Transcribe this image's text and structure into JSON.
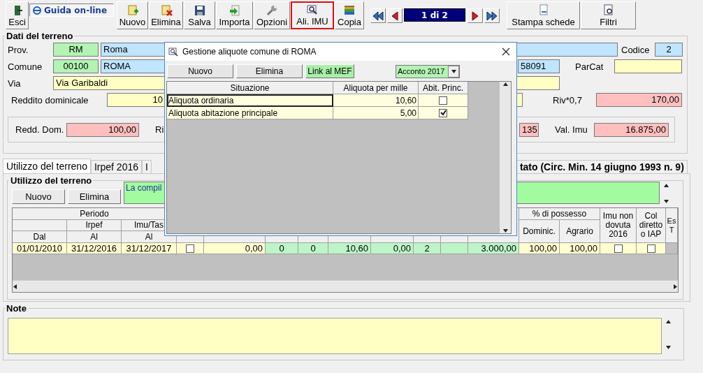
{
  "toolbar": {
    "exit": {
      "label": "Esci"
    },
    "help_link": {
      "label": "Guida on-line"
    },
    "buttons": [
      {
        "label": "Nuovo",
        "highlighted": false
      },
      {
        "label": "Elimina",
        "highlighted": false
      },
      {
        "label": "Salva",
        "highlighted": false
      },
      {
        "label": "Importa",
        "highlighted": false
      },
      {
        "label": "Opzioni",
        "highlighted": false
      },
      {
        "label": "Ali. IMU",
        "highlighted": true
      },
      {
        "label": "Copia",
        "highlighted": false
      }
    ],
    "pager": {
      "position": "1 di 2"
    },
    "print_buttons": [
      {
        "label": "Stampa schede"
      },
      {
        "label": "Filtri"
      }
    ]
  },
  "land_data": {
    "title": "Dati del terreno",
    "prov_label": "Prov.",
    "prov_code": "RM",
    "prov_name": "Roma",
    "codice_label": "Codice",
    "codice": "2",
    "comune_label": "Comune",
    "comune_code": "00100",
    "comune_name": "ROMA",
    "field_partial": "58091",
    "parcat_label": "ParCat",
    "via_label": "Via",
    "via": "Via Garibaldi",
    "reddito_label": "Reddito dominicale",
    "reddito_partial": "10",
    "riv_label": "Riv*0,7",
    "riv": "170,00",
    "summary": {
      "redd_dom_label": "Redd. Dom.",
      "redd_dom": "100,00",
      "label_partial": "Ri",
      "value_partial": "135",
      "val_imu_label": "Val. Imu",
      "val_imu": "16.875,00"
    }
  },
  "tabs": [
    {
      "label": "Utilizzo del terreno",
      "selected": true
    },
    {
      "label": "Irpef 2016",
      "selected": false
    },
    {
      "label": "I",
      "selected": false
    },
    {
      "label": "tato (Circ. Min. 14 giugno 1993 n. 9)",
      "selected": false
    }
  ],
  "usage": {
    "title": "Utilizzo del terreno",
    "buttons": [
      "Nuovo",
      "Elimina"
    ],
    "info_partial": "La compil",
    "table": {
      "period": "Periodo",
      "irpef": "Irpef",
      "imu_tas": "Imu/Tas",
      "dal": "Dal",
      "al_irpef": "Al",
      "al_imu": "Al",
      "possesso": "% di possesso",
      "dominic": "Dominic.",
      "agrario": "Agrario",
      "imu_non_dovuta": "Imu non dovuta 2016",
      "col_diretto": "Col diretto o IAP",
      "column_17": "Es T",
      "rows": [
        {
          "cells": [
            {
              "kind": "text",
              "value": "01/01/2010"
            },
            {
              "kind": "text",
              "value": "31/12/2016"
            },
            {
              "kind": "text",
              "value": "31/12/2017"
            },
            {
              "kind": "check",
              "checked": false
            },
            {
              "kind": "text",
              "value": "0,00"
            },
            {
              "kind": "text",
              "value": "0"
            },
            {
              "kind": "text",
              "value": "0"
            },
            {
              "kind": "text",
              "value": "10,60"
            },
            {
              "kind": "text",
              "value": "0,00"
            },
            {
              "kind": "text",
              "value": "2"
            },
            {
              "kind": "empty"
            },
            {
              "kind": "text",
              "value": "3.000,00"
            },
            {
              "kind": "text",
              "value": "100,00"
            },
            {
              "kind": "text",
              "value": "100,00"
            },
            {
              "kind": "check",
              "checked": false
            },
            {
              "kind": "check",
              "checked": false
            },
            {
              "kind": "blank"
            }
          ]
        }
      ]
    }
  },
  "note": {
    "title": "Note"
  },
  "dialog": {
    "title": "Gestione aliquote comune di ROMA",
    "buttons": [
      {
        "label": "Nuovo",
        "kind": "plain"
      },
      {
        "label": "Elimina",
        "kind": "plain"
      },
      {
        "label": "Link al MEF",
        "kind": "link"
      }
    ],
    "period_select": {
      "value": "Acconto 2017"
    },
    "columns": [
      "Situazione",
      "Aliquota per mille",
      "Abit. Princ."
    ],
    "rows": [
      {
        "situazione": "Aliquota ordinaria",
        "aliquota": "10,60",
        "abit_princ": false,
        "selected": true
      },
      {
        "situazione": "Aliquota abitazione principale",
        "aliquota": "5,00",
        "abit_princ": true,
        "selected": false
      }
    ]
  }
}
